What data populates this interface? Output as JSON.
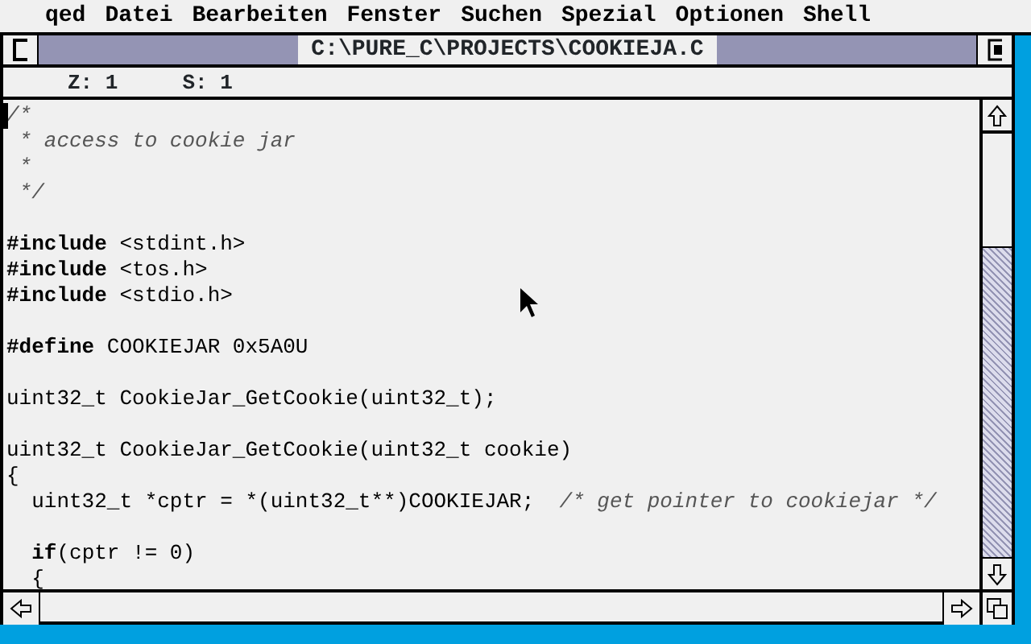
{
  "menu_bar": [
    "qed",
    "Datei",
    "Bearbeiten",
    "Fenster",
    "Suchen",
    "Spezial",
    "Optionen",
    "Shell"
  ],
  "window": {
    "title": "C:\\PURE_C\\PROJECTS\\COOKIEJA.C",
    "info": [
      {
        "label": "Z:",
        "value": "1"
      },
      {
        "label": "S:",
        "value": "1"
      }
    ]
  },
  "editor": {
    "lines": [
      {
        "segments": [
          {
            "kind": "comment",
            "text": "/*"
          }
        ]
      },
      {
        "segments": [
          {
            "kind": "comment",
            "text": " * access to cookie jar"
          }
        ]
      },
      {
        "segments": [
          {
            "kind": "comment",
            "text": " *"
          }
        ]
      },
      {
        "segments": [
          {
            "kind": "comment",
            "text": " */"
          }
        ]
      },
      {
        "kind": "blank"
      },
      {
        "segments": [
          {
            "kind": "keyword",
            "text": "#include"
          },
          {
            "kind": "code",
            "text": " <stdint.h>"
          }
        ]
      },
      {
        "segments": [
          {
            "kind": "keyword",
            "text": "#include"
          },
          {
            "kind": "code",
            "text": " <tos.h>"
          }
        ]
      },
      {
        "segments": [
          {
            "kind": "keyword",
            "text": "#include"
          },
          {
            "kind": "code",
            "text": " <stdio.h>"
          }
        ]
      },
      {
        "kind": "blank"
      },
      {
        "segments": [
          {
            "kind": "keyword",
            "text": "#define"
          },
          {
            "kind": "code",
            "text": " COOKIEJAR 0x5A0U"
          }
        ]
      },
      {
        "kind": "blank"
      },
      {
        "segments": [
          {
            "kind": "code",
            "text": "uint32_t CookieJar_GetCookie(uint32_t);"
          }
        ]
      },
      {
        "kind": "blank"
      },
      {
        "segments": [
          {
            "kind": "code",
            "text": "uint32_t CookieJar_GetCookie(uint32_t cookie)"
          }
        ]
      },
      {
        "segments": [
          {
            "kind": "code",
            "text": "{"
          }
        ]
      },
      {
        "segments": [
          {
            "kind": "code",
            "text": "  uint32_t *cptr = *(uint32_t**)COOKIEJAR;  "
          },
          {
            "kind": "comment",
            "text": "/* get pointer to cookiejar */"
          }
        ]
      },
      {
        "kind": "blank"
      },
      {
        "segments": [
          {
            "kind": "keyword",
            "text": "  if"
          },
          {
            "kind": "code",
            "text": "(cptr != 0)"
          }
        ]
      },
      {
        "segments": [
          {
            "kind": "code",
            "text": "  {"
          }
        ]
      }
    ]
  }
}
